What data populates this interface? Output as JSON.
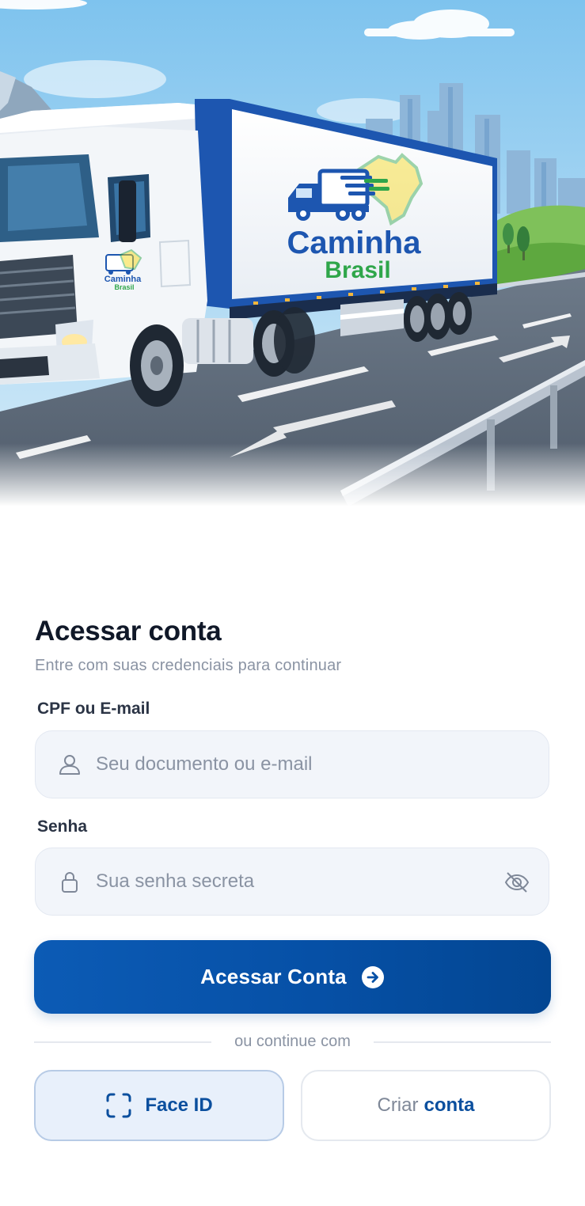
{
  "hero": {
    "brand_line1": "Caminha",
    "brand_line2": "Brasil",
    "cab_brand_line1": "Caminha",
    "cab_brand_line2": "Brasil"
  },
  "login": {
    "title": "Acessar conta",
    "subtitle": "Entre com suas credenciais para continuar"
  },
  "fields": {
    "user": {
      "label": "CPF ou E-mail",
      "placeholder": "Seu documento ou e-mail",
      "icon": "user-icon"
    },
    "password": {
      "label": "Senha",
      "placeholder": "Sua senha secreta",
      "icon": "lock-icon",
      "toggle_icon": "eye-off-icon"
    }
  },
  "actions": {
    "primary_label": "Acessar Conta",
    "primary_icon": "arrow-right-circle-icon",
    "divider_text": "ou continue com",
    "faceid_label": "Face ID",
    "faceid_icon": "face-id-icon",
    "create_prefix": "Criar",
    "create_bold": "conta"
  },
  "colors": {
    "primary": "#0650a6",
    "heading": "#101828",
    "muted": "#8a93a3",
    "input_bg": "#f2f5fa"
  }
}
